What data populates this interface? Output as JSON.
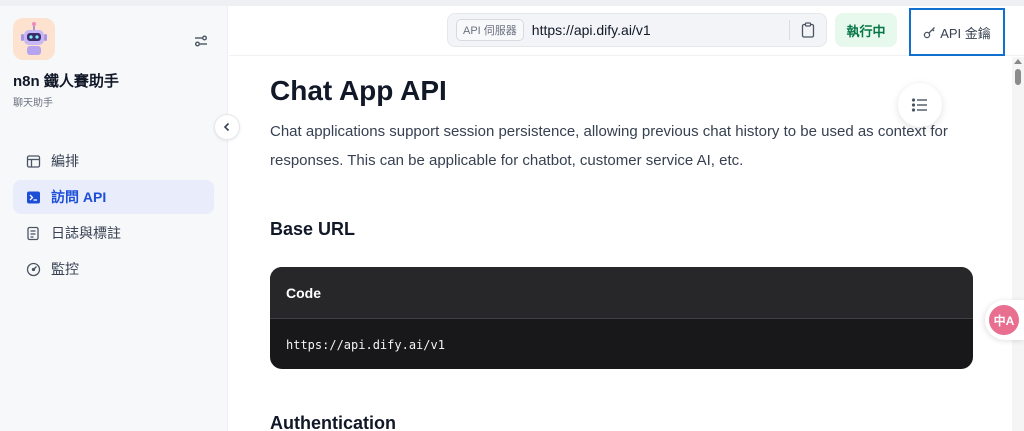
{
  "app": {
    "name": "n8n 鐵人賽助手",
    "type": "聊天助手"
  },
  "nav": [
    {
      "label": "編排",
      "icon": "layout-icon",
      "active": false
    },
    {
      "label": "訪問 API",
      "icon": "terminal-icon",
      "active": true
    },
    {
      "label": "日誌與標註",
      "icon": "log-icon",
      "active": false
    },
    {
      "label": "監控",
      "icon": "gauge-icon",
      "active": false
    }
  ],
  "header": {
    "server_label": "API 伺服器",
    "server_url": "https://api.dify.ai/v1",
    "status": "執行中",
    "api_key_label": "API 金鑰"
  },
  "doc": {
    "title": "Chat App API",
    "intro": "Chat applications support session persistence, allowing previous chat history to be used as context for responses. This can be applicable for chatbot, customer service AI, etc.",
    "base_url_heading": "Base URL",
    "code_title": "Code",
    "code_text": "https://api.dify.ai/v1",
    "auth_heading": "Authentication"
  },
  "translate_badge": "中A",
  "colors": {
    "accent": "#1d4ed8",
    "status_bg": "#e7f8ec",
    "status_text": "#067647",
    "highlight_border": "#1170cf"
  }
}
